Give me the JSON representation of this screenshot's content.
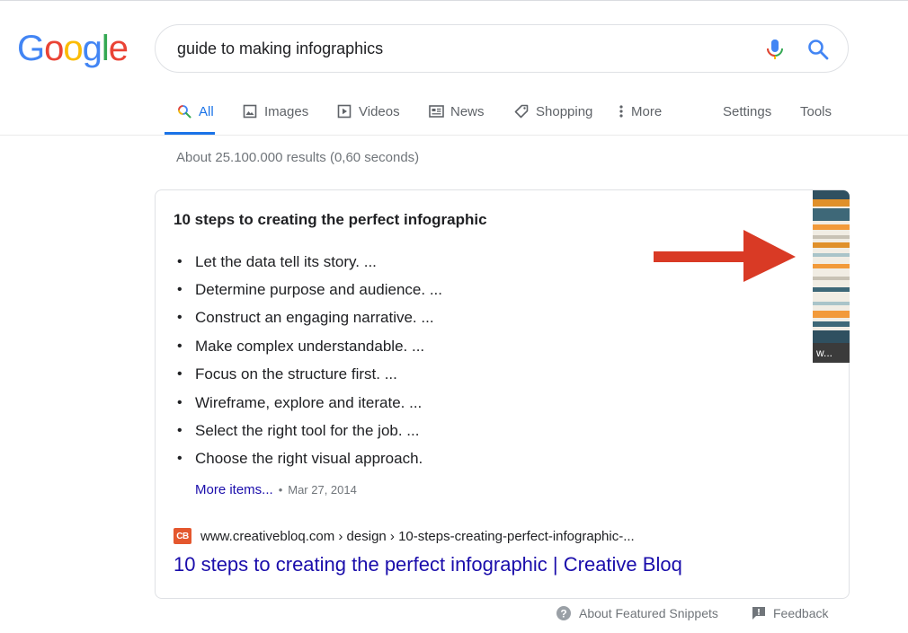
{
  "logo": {
    "letters": [
      "G",
      "o",
      "o",
      "g",
      "l",
      "e"
    ],
    "colors": [
      "#4285F4",
      "#EA4335",
      "#FBBC05",
      "#4285F4",
      "#34A853",
      "#EA4335"
    ]
  },
  "search": {
    "query": "guide to making infographics"
  },
  "tabs": [
    {
      "label": "All",
      "icon": "search-icon",
      "active": true
    },
    {
      "label": "Images",
      "icon": "image-icon"
    },
    {
      "label": "Videos",
      "icon": "play-icon"
    },
    {
      "label": "News",
      "icon": "newspaper-icon"
    },
    {
      "label": "Shopping",
      "icon": "tag-icon"
    },
    {
      "label": "More",
      "icon": "more-vertical-icon"
    }
  ],
  "tools": {
    "settings": "Settings",
    "tools": "Tools"
  },
  "result_stats": "About 25.100.000 results (0,60 seconds)",
  "snippet": {
    "title": "10 steps to creating the perfect infographic",
    "items": [
      "Let the data tell its story. ...",
      "Determine purpose and audience. ...",
      "Construct an engaging narrative. ...",
      "Make complex understandable. ...",
      "Focus on the structure first. ...",
      "Wireframe, explore and iterate. ...",
      "Select the right tool for the job. ...",
      "Choose the right visual approach."
    ],
    "more_items": "More items...",
    "separator": "•",
    "date": "Mar 27, 2014",
    "thumbnail_caption": "w...",
    "favicon_text": "CB",
    "cite": "www.creativebloq.com › design › 10-steps-creating-perfect-infographic-...",
    "link_title": "10 steps to creating the perfect infographic | Creative Bloq"
  },
  "footer": {
    "about": "About Featured Snippets",
    "feedback": "Feedback"
  },
  "colors": {
    "accent": "#1a73e8",
    "link": "#1a0dab",
    "arrow": "#d93a25",
    "muted": "#70757a"
  }
}
